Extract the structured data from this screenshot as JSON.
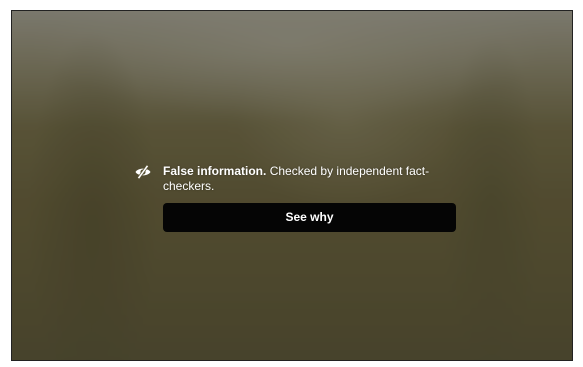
{
  "notice": {
    "icon": "eye-slash-icon",
    "title": "False information.",
    "message": " Checked by independent fact-checkers."
  },
  "actions": {
    "see_why_label": "See why"
  },
  "colors": {
    "button_bg": "#050505",
    "text": "#ffffff"
  }
}
